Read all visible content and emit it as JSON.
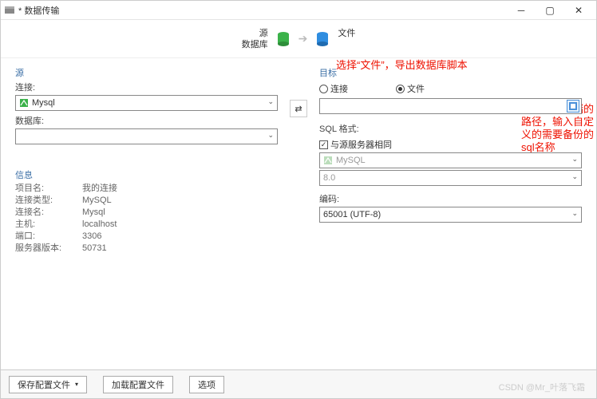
{
  "title": "* 数据传输",
  "flow": {
    "source_label_top": "源",
    "source_label_bottom": "数据库",
    "target_label_top": "文件"
  },
  "left": {
    "section": "源",
    "conn_label": "连接:",
    "conn_value": "Mysql",
    "db_label": "数据库:",
    "db_value": "",
    "info_title": "信息",
    "info": {
      "project_k": "项目名:",
      "project_v": "我的连接",
      "conntype_k": "连接类型:",
      "conntype_v": "MySQL",
      "connname_k": "连接名:",
      "connname_v": "Mysql",
      "host_k": "主机:",
      "host_v": "localhost",
      "port_k": "端口:",
      "port_v": "3306",
      "srvver_k": "服务器版本:",
      "srvver_v": "50731"
    }
  },
  "right": {
    "section": "目标",
    "radio_conn": "连接",
    "radio_file": "文件",
    "file_value": "",
    "sqlfmt_label": "SQL 格式:",
    "same_as_src": "与源服务器相同",
    "db_type": "MySQL",
    "db_ver": "8.0",
    "enc_label": "编码:",
    "enc_value": "65001 (UTF-8)"
  },
  "annot1": "选择“文件”，导出数据库脚本",
  "annot2": "选择导出存储的路径，输入自定义的需要备份的sql名称",
  "footer": {
    "save": "保存配置文件",
    "load": "加载配置文件",
    "options": "选项"
  },
  "watermark": "CSDN @Mr_叶落飞霜"
}
